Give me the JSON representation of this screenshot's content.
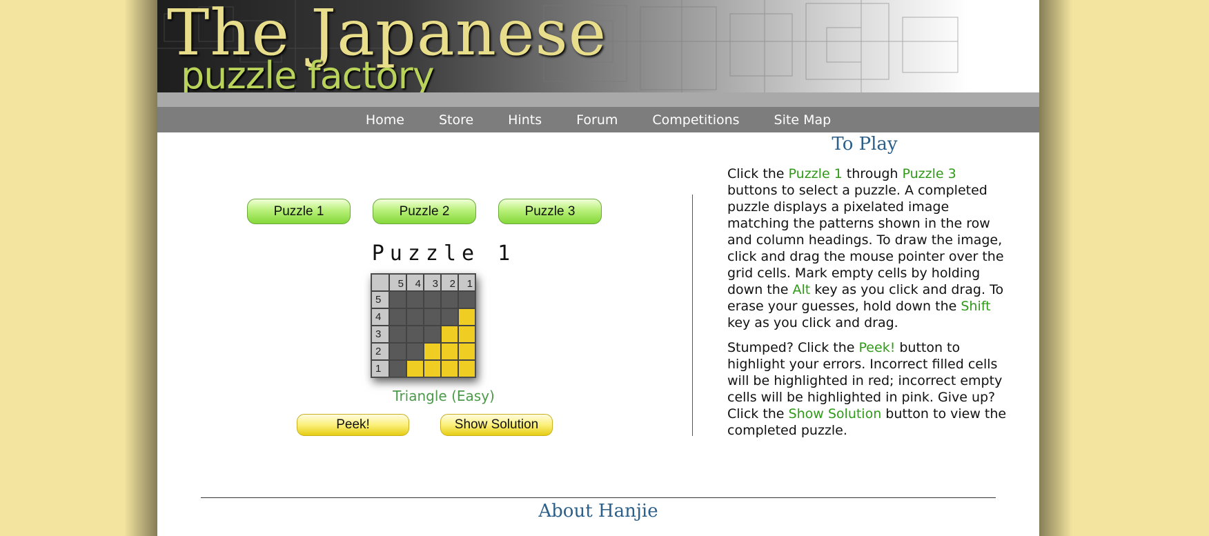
{
  "banner": {
    "title": "The Japanese",
    "subtitle": "puzzle factory"
  },
  "nav": {
    "items": [
      "Home",
      "Store",
      "Hints",
      "Forum",
      "Competitions",
      "Site Map"
    ]
  },
  "puzzle_buttons": [
    "Puzzle 1",
    "Puzzle 2",
    "Puzzle 3"
  ],
  "puzzle": {
    "title": "Puzzle 1",
    "column_clues": [
      "5",
      "4",
      "3",
      "2",
      "1"
    ],
    "row_clues": [
      "5",
      "4",
      "3",
      "2",
      "1"
    ],
    "cells": [
      [
        0,
        0,
        0,
        0,
        0
      ],
      [
        0,
        0,
        0,
        0,
        1
      ],
      [
        0,
        0,
        0,
        1,
        1
      ],
      [
        0,
        0,
        1,
        1,
        1
      ],
      [
        0,
        1,
        1,
        1,
        1
      ]
    ],
    "label": "Triangle (Easy)"
  },
  "actions": {
    "peek_label": "Peek!",
    "solution_label": "Show Solution"
  },
  "to_play": {
    "title": "To Play",
    "p1": {
      "a": "Click the ",
      "b": "Puzzle 1",
      "c": " through ",
      "d": "Puzzle 3",
      "e": " buttons to select a puzzle. A completed puzzle displays a pixelated image matching the patterns shown in the row and column headings. To draw the image, click and drag the mouse pointer over the grid cells. Mark empty cells by holding down the ",
      "f": "Alt",
      "g": " key as you click and drag. To erase your guesses, hold down the ",
      "h": "Shift",
      "i": " key as you click and drag."
    },
    "p2": {
      "a": "Stumped? Click the ",
      "b": "Peek!",
      "c": " button to highlight your errors. Incorrect filled cells will be highlighted in red; incorrect empty cells will be highlighted in pink. Give up? Click the ",
      "d": "Show Solution",
      "e": " button to view the completed puzzle."
    }
  },
  "about": {
    "title": "About Hanjie"
  },
  "colors": {
    "background": "#f3e49f",
    "filled_cell": "#f0cd22",
    "empty_cell": "#595959",
    "accent_green": "#2f9a17",
    "heading_blue": "#2b5f8a"
  }
}
